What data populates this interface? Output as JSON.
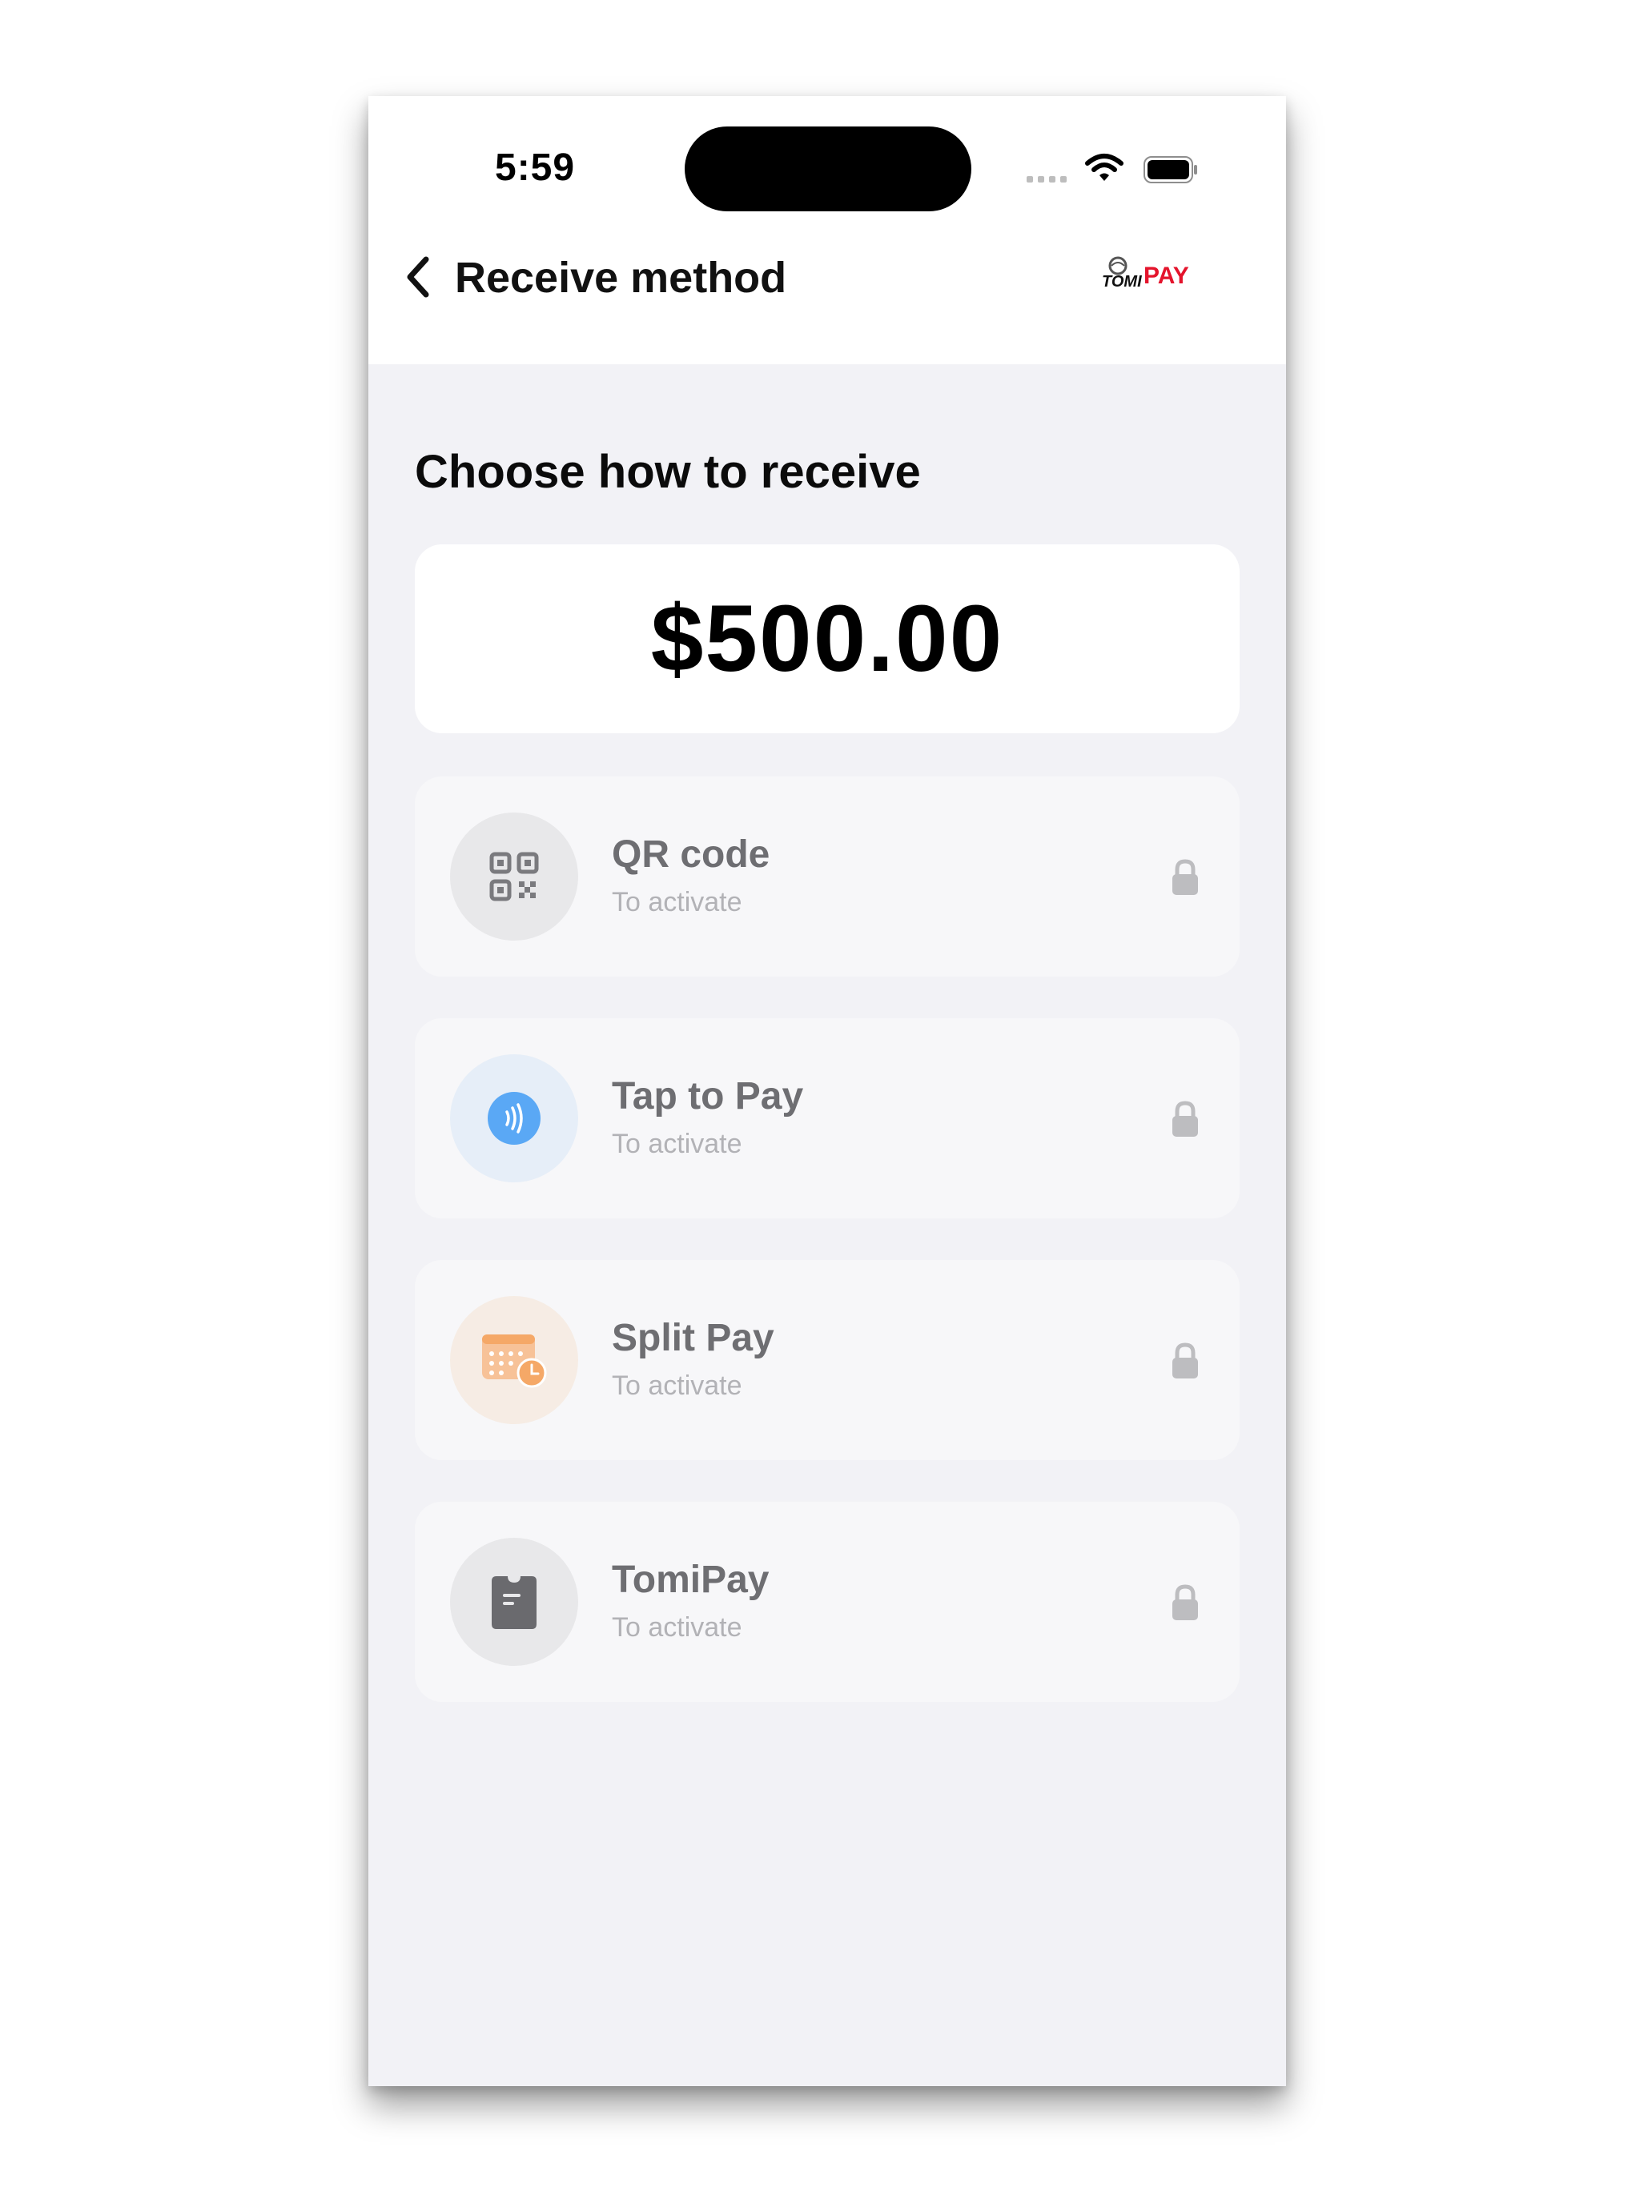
{
  "status_bar": {
    "time": "5:59",
    "icons": [
      "signal-dots-icon",
      "wifi-icon",
      "battery-icon"
    ]
  },
  "nav": {
    "back_icon": "chevron-left-icon",
    "title": "Receive method",
    "logo_text": "TOMI",
    "logo_pay": "PAY",
    "logo_color": "#e4142c"
  },
  "section_title": "Choose how to receive",
  "amount": "$500.00",
  "methods": [
    {
      "title": "QR code",
      "subtitle": "To activate",
      "icon": "qr-code-icon",
      "locked": true
    },
    {
      "title": "Tap to Pay",
      "subtitle": "To activate",
      "icon": "contactless-icon",
      "locked": true
    },
    {
      "title": "Split Pay",
      "subtitle": "To activate",
      "icon": "calendar-clock-icon",
      "locked": true
    },
    {
      "title": "TomiPay",
      "subtitle": "To activate",
      "icon": "card-reader-icon",
      "locked": true
    }
  ],
  "colors": {
    "background": "#f2f2f6",
    "card": "#f7f7f9",
    "title": "#6e6e72",
    "subtitle": "#b2b2b6",
    "tap_accent": "#5aa8f5",
    "split_accent": "#f5a867"
  }
}
